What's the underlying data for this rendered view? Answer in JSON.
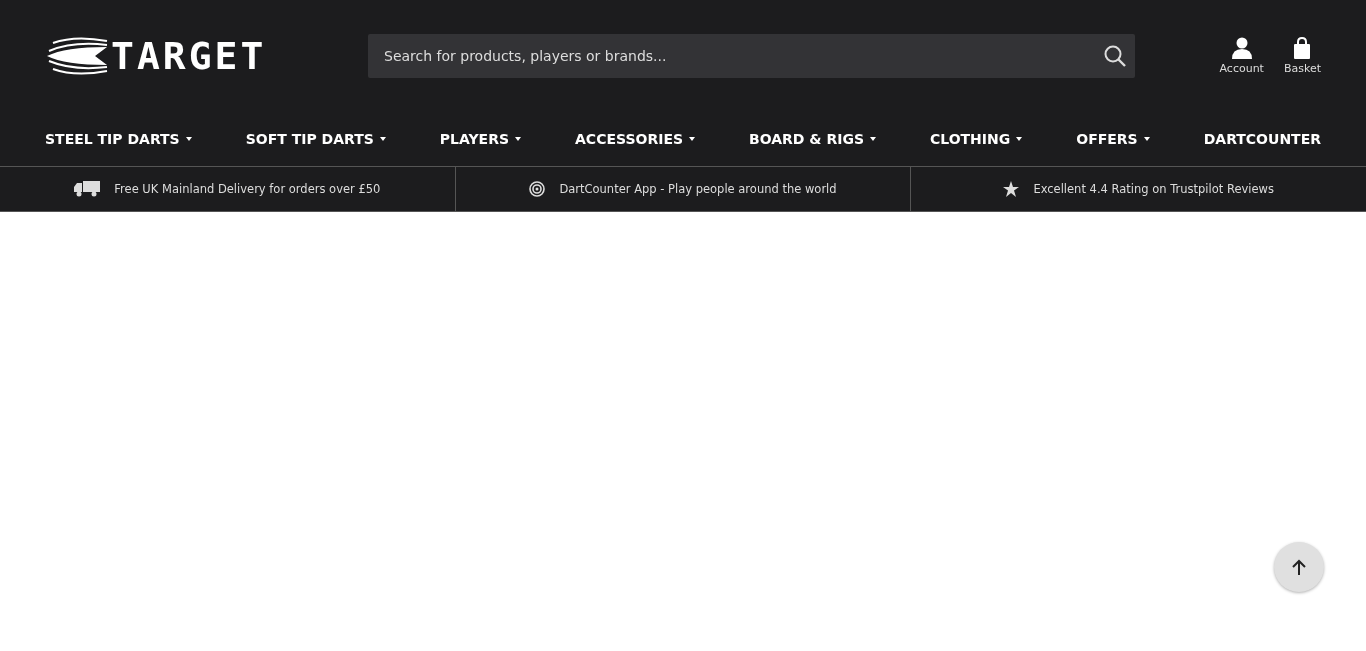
{
  "logo": {
    "text": "TARGET"
  },
  "search": {
    "placeholder": "Search for products, players or brands..."
  },
  "account": {
    "label": "Account"
  },
  "basket": {
    "label": "Basket"
  },
  "nav": [
    {
      "label": "STEEL TIP DARTS",
      "dropdown": true
    },
    {
      "label": "SOFT TIP DARTS",
      "dropdown": true
    },
    {
      "label": "PLAYERS",
      "dropdown": true
    },
    {
      "label": "ACCESSORIES",
      "dropdown": true
    },
    {
      "label": "BOARD & RIGS",
      "dropdown": true
    },
    {
      "label": "CLOTHING",
      "dropdown": true
    },
    {
      "label": "OFFERS",
      "dropdown": true
    },
    {
      "label": "DARTCOUNTER",
      "dropdown": false
    }
  ],
  "usps": [
    {
      "kind": "truck",
      "text": "Free UK Mainland Delivery for orders over £50"
    },
    {
      "kind": "target",
      "text": "DartCounter App - Play people around the world"
    },
    {
      "kind": "star",
      "text": "Excellent 4.4 Rating on Trustpilot Reviews"
    }
  ]
}
